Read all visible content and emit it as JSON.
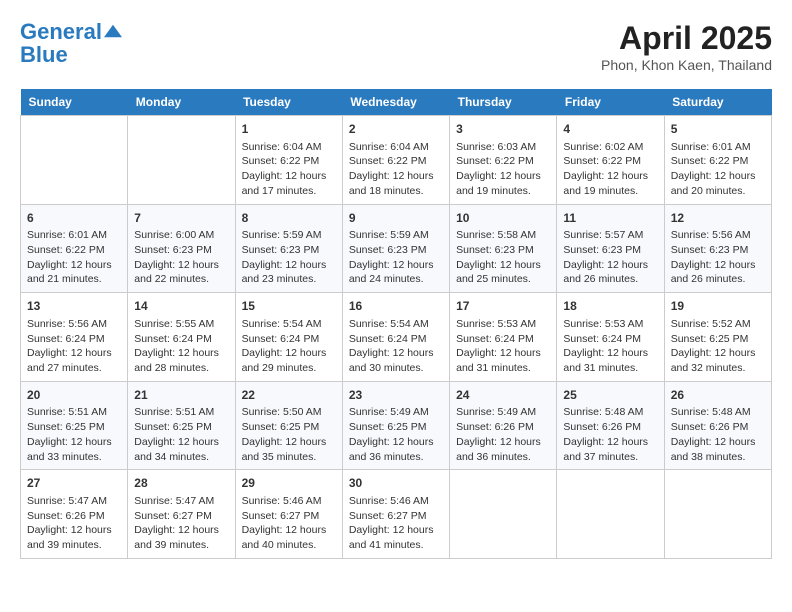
{
  "header": {
    "logo_line1": "General",
    "logo_line2": "Blue",
    "month_year": "April 2025",
    "location": "Phon, Khon Kaen, Thailand"
  },
  "weekdays": [
    "Sunday",
    "Monday",
    "Tuesday",
    "Wednesday",
    "Thursday",
    "Friday",
    "Saturday"
  ],
  "weeks": [
    [
      {
        "day": "",
        "sunrise": "",
        "sunset": "",
        "daylight": ""
      },
      {
        "day": "",
        "sunrise": "",
        "sunset": "",
        "daylight": ""
      },
      {
        "day": "1",
        "sunrise": "Sunrise: 6:04 AM",
        "sunset": "Sunset: 6:22 PM",
        "daylight": "Daylight: 12 hours and 17 minutes."
      },
      {
        "day": "2",
        "sunrise": "Sunrise: 6:04 AM",
        "sunset": "Sunset: 6:22 PM",
        "daylight": "Daylight: 12 hours and 18 minutes."
      },
      {
        "day": "3",
        "sunrise": "Sunrise: 6:03 AM",
        "sunset": "Sunset: 6:22 PM",
        "daylight": "Daylight: 12 hours and 19 minutes."
      },
      {
        "day": "4",
        "sunrise": "Sunrise: 6:02 AM",
        "sunset": "Sunset: 6:22 PM",
        "daylight": "Daylight: 12 hours and 19 minutes."
      },
      {
        "day": "5",
        "sunrise": "Sunrise: 6:01 AM",
        "sunset": "Sunset: 6:22 PM",
        "daylight": "Daylight: 12 hours and 20 minutes."
      }
    ],
    [
      {
        "day": "6",
        "sunrise": "Sunrise: 6:01 AM",
        "sunset": "Sunset: 6:22 PM",
        "daylight": "Daylight: 12 hours and 21 minutes."
      },
      {
        "day": "7",
        "sunrise": "Sunrise: 6:00 AM",
        "sunset": "Sunset: 6:23 PM",
        "daylight": "Daylight: 12 hours and 22 minutes."
      },
      {
        "day": "8",
        "sunrise": "Sunrise: 5:59 AM",
        "sunset": "Sunset: 6:23 PM",
        "daylight": "Daylight: 12 hours and 23 minutes."
      },
      {
        "day": "9",
        "sunrise": "Sunrise: 5:59 AM",
        "sunset": "Sunset: 6:23 PM",
        "daylight": "Daylight: 12 hours and 24 minutes."
      },
      {
        "day": "10",
        "sunrise": "Sunrise: 5:58 AM",
        "sunset": "Sunset: 6:23 PM",
        "daylight": "Daylight: 12 hours and 25 minutes."
      },
      {
        "day": "11",
        "sunrise": "Sunrise: 5:57 AM",
        "sunset": "Sunset: 6:23 PM",
        "daylight": "Daylight: 12 hours and 26 minutes."
      },
      {
        "day": "12",
        "sunrise": "Sunrise: 5:56 AM",
        "sunset": "Sunset: 6:23 PM",
        "daylight": "Daylight: 12 hours and 26 minutes."
      }
    ],
    [
      {
        "day": "13",
        "sunrise": "Sunrise: 5:56 AM",
        "sunset": "Sunset: 6:24 PM",
        "daylight": "Daylight: 12 hours and 27 minutes."
      },
      {
        "day": "14",
        "sunrise": "Sunrise: 5:55 AM",
        "sunset": "Sunset: 6:24 PM",
        "daylight": "Daylight: 12 hours and 28 minutes."
      },
      {
        "day": "15",
        "sunrise": "Sunrise: 5:54 AM",
        "sunset": "Sunset: 6:24 PM",
        "daylight": "Daylight: 12 hours and 29 minutes."
      },
      {
        "day": "16",
        "sunrise": "Sunrise: 5:54 AM",
        "sunset": "Sunset: 6:24 PM",
        "daylight": "Daylight: 12 hours and 30 minutes."
      },
      {
        "day": "17",
        "sunrise": "Sunrise: 5:53 AM",
        "sunset": "Sunset: 6:24 PM",
        "daylight": "Daylight: 12 hours and 31 minutes."
      },
      {
        "day": "18",
        "sunrise": "Sunrise: 5:53 AM",
        "sunset": "Sunset: 6:24 PM",
        "daylight": "Daylight: 12 hours and 31 minutes."
      },
      {
        "day": "19",
        "sunrise": "Sunrise: 5:52 AM",
        "sunset": "Sunset: 6:25 PM",
        "daylight": "Daylight: 12 hours and 32 minutes."
      }
    ],
    [
      {
        "day": "20",
        "sunrise": "Sunrise: 5:51 AM",
        "sunset": "Sunset: 6:25 PM",
        "daylight": "Daylight: 12 hours and 33 minutes."
      },
      {
        "day": "21",
        "sunrise": "Sunrise: 5:51 AM",
        "sunset": "Sunset: 6:25 PM",
        "daylight": "Daylight: 12 hours and 34 minutes."
      },
      {
        "day": "22",
        "sunrise": "Sunrise: 5:50 AM",
        "sunset": "Sunset: 6:25 PM",
        "daylight": "Daylight: 12 hours and 35 minutes."
      },
      {
        "day": "23",
        "sunrise": "Sunrise: 5:49 AM",
        "sunset": "Sunset: 6:25 PM",
        "daylight": "Daylight: 12 hours and 36 minutes."
      },
      {
        "day": "24",
        "sunrise": "Sunrise: 5:49 AM",
        "sunset": "Sunset: 6:26 PM",
        "daylight": "Daylight: 12 hours and 36 minutes."
      },
      {
        "day": "25",
        "sunrise": "Sunrise: 5:48 AM",
        "sunset": "Sunset: 6:26 PM",
        "daylight": "Daylight: 12 hours and 37 minutes."
      },
      {
        "day": "26",
        "sunrise": "Sunrise: 5:48 AM",
        "sunset": "Sunset: 6:26 PM",
        "daylight": "Daylight: 12 hours and 38 minutes."
      }
    ],
    [
      {
        "day": "27",
        "sunrise": "Sunrise: 5:47 AM",
        "sunset": "Sunset: 6:26 PM",
        "daylight": "Daylight: 12 hours and 39 minutes."
      },
      {
        "day": "28",
        "sunrise": "Sunrise: 5:47 AM",
        "sunset": "Sunset: 6:27 PM",
        "daylight": "Daylight: 12 hours and 39 minutes."
      },
      {
        "day": "29",
        "sunrise": "Sunrise: 5:46 AM",
        "sunset": "Sunset: 6:27 PM",
        "daylight": "Daylight: 12 hours and 40 minutes."
      },
      {
        "day": "30",
        "sunrise": "Sunrise: 5:46 AM",
        "sunset": "Sunset: 6:27 PM",
        "daylight": "Daylight: 12 hours and 41 minutes."
      },
      {
        "day": "",
        "sunrise": "",
        "sunset": "",
        "daylight": ""
      },
      {
        "day": "",
        "sunrise": "",
        "sunset": "",
        "daylight": ""
      },
      {
        "day": "",
        "sunrise": "",
        "sunset": "",
        "daylight": ""
      }
    ]
  ]
}
